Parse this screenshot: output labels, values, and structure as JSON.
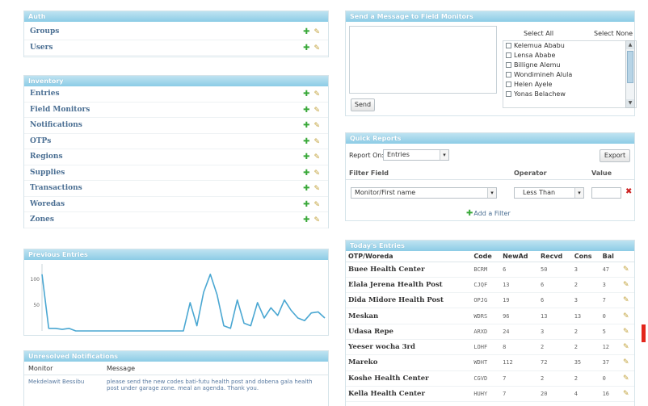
{
  "auth": {
    "title": "Auth",
    "items": [
      {
        "label": "Groups"
      },
      {
        "label": "Users"
      }
    ]
  },
  "inventory": {
    "title": "Inventory",
    "items": [
      {
        "label": "Entries"
      },
      {
        "label": "Field Monitors"
      },
      {
        "label": "Notifications"
      },
      {
        "label": "OTPs"
      },
      {
        "label": "Regions"
      },
      {
        "label": "Supplies"
      },
      {
        "label": "Transactions"
      },
      {
        "label": "Woredas"
      },
      {
        "label": "Zones"
      }
    ]
  },
  "icons": {
    "add": "plus-icon",
    "edit": "pencil-icon",
    "remove": "x-icon"
  },
  "send_message": {
    "title": "Send a Message to Field Monitors",
    "send_label": "Send",
    "select_all": "Select All",
    "select_none": "Select None",
    "recipients": [
      "Kelemua Ababu",
      "Lensa Ababe",
      "Billigne Alemu",
      "Wondimineh Alula",
      "Helen Ayele",
      "Yonas Belachew"
    ]
  },
  "quick_reports": {
    "title": "Quick Reports",
    "report_on_label": "Report On:",
    "report_on_value": "Entries",
    "export_label": "Export",
    "col_filter_field": "Filter Field",
    "col_operator": "Operator",
    "col_value": "Value",
    "filter_field_value": "Monitor/First name",
    "operator_value": "Less Than",
    "value_value": "",
    "add_filter_label": "Add a Filter"
  },
  "previous_entries": {
    "title": "Previous Entries",
    "chart_data": {
      "type": "line",
      "ylim": [
        0,
        130
      ],
      "yticks": [
        50,
        100
      ],
      "ytick_labels": [
        "50",
        "100"
      ],
      "grid": false,
      "series": [
        {
          "values": [
            110,
            5,
            5,
            3,
            5,
            0,
            0,
            0,
            0,
            0,
            0,
            0,
            0,
            0,
            0,
            0,
            0,
            0,
            0,
            0,
            0,
            0,
            55,
            10,
            75,
            110,
            70,
            10,
            5,
            60,
            15,
            10,
            55,
            25,
            45,
            30,
            60,
            40,
            25,
            20,
            35,
            37,
            25
          ]
        }
      ]
    }
  },
  "unresolved": {
    "title": "Unresolved Notifications",
    "col_monitor": "Monitor",
    "col_message": "Message",
    "rows": [
      {
        "monitor": "Mekdelawit Bessibu",
        "message": "please send the new codes bati-futu health post and dobena gala health post under garage zone. meal an agenda. Thank you."
      }
    ]
  },
  "todays_entries": {
    "title": "Today's Entries",
    "columns": [
      "OTP/Woreda",
      "Code",
      "NewAd",
      "Recvd",
      "Cons",
      "Bal"
    ],
    "rows": [
      {
        "name": "Buee Health Center",
        "code": "BCRM",
        "newad": "6",
        "recvd": "50",
        "cons": "3",
        "bal": "47"
      },
      {
        "name": "Elala Jerena Health Post",
        "code": "CJQF",
        "newad": "13",
        "recvd": "6",
        "cons": "2",
        "bal": "3"
      },
      {
        "name": "Dida Midore Health Post",
        "code": "OPJG",
        "newad": "19",
        "recvd": "6",
        "cons": "3",
        "bal": "7"
      },
      {
        "name": "Meskan",
        "code": "WDRS",
        "newad": "96",
        "recvd": "13",
        "cons": "13",
        "bal": "0"
      },
      {
        "name": "Udasa Repe",
        "code": "ARXD",
        "newad": "24",
        "recvd": "3",
        "cons": "2",
        "bal": "5"
      },
      {
        "name": "Yeeser wocha 3rd",
        "code": "LOHF",
        "newad": "8",
        "recvd": "2",
        "cons": "2",
        "bal": "12"
      },
      {
        "name": "Mareko",
        "code": "WDHT",
        "newad": "112",
        "recvd": "72",
        "cons": "35",
        "bal": "37"
      },
      {
        "name": "Koshe Health Center",
        "code": "CGVD",
        "newad": "7",
        "recvd": "2",
        "cons": "2",
        "bal": "0"
      },
      {
        "name": "Kella Health Center",
        "code": "HUHY",
        "newad": "7",
        "recvd": "20",
        "cons": "4",
        "bal": "16"
      }
    ]
  }
}
